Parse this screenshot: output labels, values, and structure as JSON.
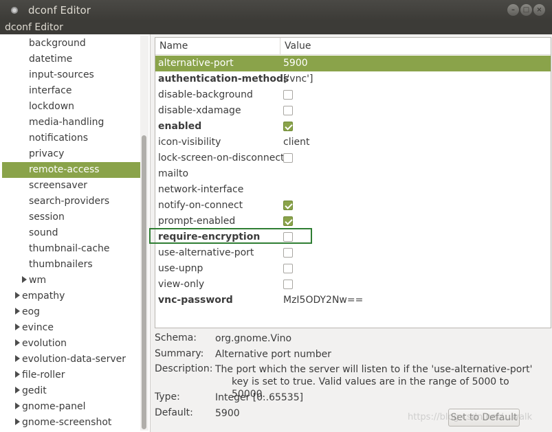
{
  "window": {
    "title": "dconf Editor"
  },
  "menubar": {
    "app_menu": "dconf Editor"
  },
  "sidebar": {
    "items": [
      {
        "label": "background",
        "expander": false,
        "selected": false
      },
      {
        "label": "datetime",
        "expander": false,
        "selected": false
      },
      {
        "label": "input-sources",
        "expander": false,
        "selected": false
      },
      {
        "label": "interface",
        "expander": false,
        "selected": false
      },
      {
        "label": "lockdown",
        "expander": false,
        "selected": false
      },
      {
        "label": "media-handling",
        "expander": false,
        "selected": false
      },
      {
        "label": "notifications",
        "expander": false,
        "selected": false
      },
      {
        "label": "privacy",
        "expander": false,
        "selected": false
      },
      {
        "label": "remote-access",
        "expander": false,
        "selected": true
      },
      {
        "label": "screensaver",
        "expander": false,
        "selected": false
      },
      {
        "label": "search-providers",
        "expander": false,
        "selected": false
      },
      {
        "label": "session",
        "expander": false,
        "selected": false
      },
      {
        "label": "sound",
        "expander": false,
        "selected": false
      },
      {
        "label": "thumbnail-cache",
        "expander": false,
        "selected": false
      },
      {
        "label": "thumbnailers",
        "expander": false,
        "selected": false
      },
      {
        "label": "wm",
        "expander": true,
        "selected": false
      },
      {
        "label": "empathy",
        "expander": true,
        "selected": false
      },
      {
        "label": "eog",
        "expander": true,
        "selected": false
      },
      {
        "label": "evince",
        "expander": true,
        "selected": false
      },
      {
        "label": "evolution",
        "expander": true,
        "selected": false
      },
      {
        "label": "evolution-data-server",
        "expander": true,
        "selected": false
      },
      {
        "label": "file-roller",
        "expander": true,
        "selected": false
      },
      {
        "label": "gedit",
        "expander": true,
        "selected": false
      },
      {
        "label": "gnome-panel",
        "expander": true,
        "selected": false
      },
      {
        "label": "gnome-screenshot",
        "expander": true,
        "selected": false
      }
    ]
  },
  "table": {
    "headers": {
      "name": "Name",
      "value": "Value"
    },
    "rows": [
      {
        "key": "alternative-port",
        "value": "5900",
        "type": "text",
        "bold": false,
        "selected": true
      },
      {
        "key": "authentication-methods",
        "value": "['vnc']",
        "type": "text",
        "bold": true,
        "selected": false
      },
      {
        "key": "disable-background",
        "checked": false,
        "type": "bool",
        "bold": false,
        "selected": false
      },
      {
        "key": "disable-xdamage",
        "checked": false,
        "type": "bool",
        "bold": false,
        "selected": false
      },
      {
        "key": "enabled",
        "checked": true,
        "type": "bool",
        "bold": true,
        "selected": false
      },
      {
        "key": "icon-visibility",
        "value": "client",
        "type": "text",
        "bold": false,
        "selected": false
      },
      {
        "key": "lock-screen-on-disconnect",
        "checked": false,
        "type": "bool",
        "bold": false,
        "selected": false
      },
      {
        "key": "mailto",
        "value": "",
        "type": "text",
        "bold": false,
        "selected": false
      },
      {
        "key": "network-interface",
        "value": "",
        "type": "text",
        "bold": false,
        "selected": false
      },
      {
        "key": "notify-on-connect",
        "checked": true,
        "type": "bool",
        "bold": false,
        "selected": false
      },
      {
        "key": "prompt-enabled",
        "checked": true,
        "type": "bool",
        "bold": false,
        "selected": false
      },
      {
        "key": "require-encryption",
        "checked": false,
        "type": "bool",
        "bold": true,
        "selected": false
      },
      {
        "key": "use-alternative-port",
        "checked": false,
        "type": "bool",
        "bold": false,
        "selected": false
      },
      {
        "key": "use-upnp",
        "checked": false,
        "type": "bool",
        "bold": false,
        "selected": false
      },
      {
        "key": "view-only",
        "checked": false,
        "type": "bool",
        "bold": false,
        "selected": false
      },
      {
        "key": "vnc-password",
        "value": "MzI5ODY2Nw==",
        "type": "text",
        "bold": true,
        "selected": false
      }
    ]
  },
  "details": {
    "schema_label": "Schema:",
    "schema": "org.gnome.Vino",
    "summary_label": "Summary:",
    "summary": "Alternative port number",
    "description_label": "Description:",
    "description_line1": "The port which the server will listen to if the 'use-alternative-port'",
    "description_line2": "key is set to true. Valid values are in the range of 5000 to 50000.",
    "type_label": "Type:",
    "type": "Integer [0..65535]",
    "default_label": "Default:",
    "default": "5900"
  },
  "buttons": {
    "set_to_default": "Set to Default"
  },
  "watermark": "https://blog.csdn.net/...walk",
  "colors": {
    "selection": "#8aa34a",
    "titlebar": "#3c3b37",
    "highlight_box": "#2e7d32"
  }
}
